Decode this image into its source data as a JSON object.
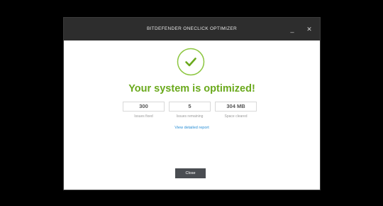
{
  "window": {
    "title": "BITDEFENDER ONECLICK OPTIMIZER",
    "minimize_glyph": "_",
    "close_glyph": "✕"
  },
  "result": {
    "icon": "checkmark-icon",
    "headline": "Your system is optimized!"
  },
  "stats": [
    {
      "value": "300",
      "label": "Issues fixed"
    },
    {
      "value": "5",
      "label": "Issues remaining"
    },
    {
      "value": "304 MB",
      "label": "Space cleared"
    }
  ],
  "link": {
    "label": "View detailed report"
  },
  "actions": {
    "close_label": "Close"
  },
  "colors": {
    "accent_green": "#6aa91c",
    "link_blue": "#2a8fd6",
    "titlebar": "#2d2d2d",
    "button": "#4a4d52"
  }
}
